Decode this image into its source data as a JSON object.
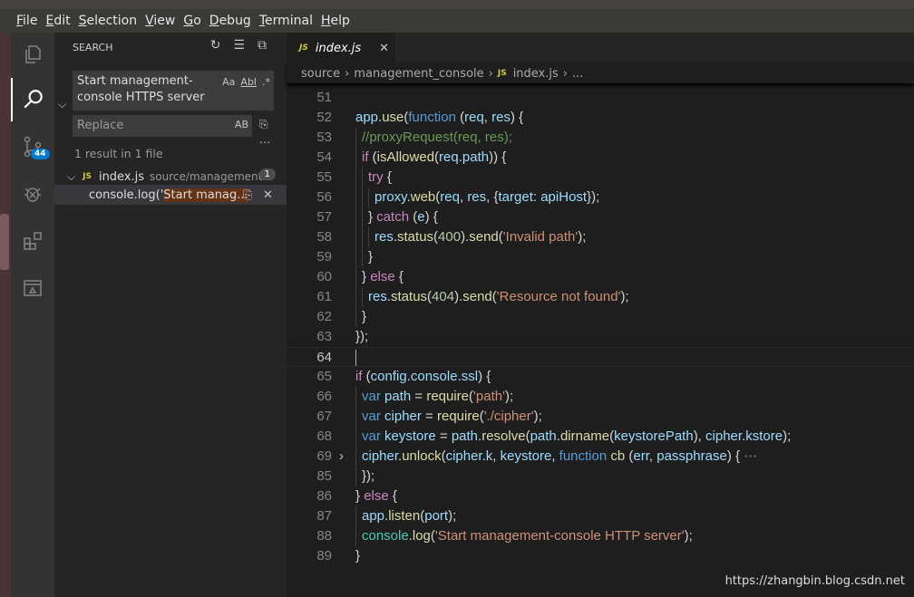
{
  "menu": [
    "File",
    "Edit",
    "Selection",
    "View",
    "Go",
    "Debug",
    "Terminal",
    "Help"
  ],
  "activity": {
    "scm_badge": "44"
  },
  "sidebar": {
    "title": "SEARCH",
    "search_value": "Start management-console HTTPS server",
    "opt_case": "Aa",
    "opt_word": "Abl",
    "opt_regex": ".*",
    "replace_placeholder": "Replace",
    "replace_ab": "AB",
    "summary": "1 result in 1 file",
    "file": {
      "name": "index.js",
      "path": "source/management...",
      "count": "1",
      "icon": "JS"
    },
    "match": {
      "prefix": "console.log('",
      "highlight": "Start manag..."
    }
  },
  "tab": {
    "icon": "JS",
    "label": "index.js"
  },
  "breadcrumb": [
    "source",
    "management_console",
    "index.js",
    "..."
  ],
  "code": [
    {
      "n": "51",
      "i": 0,
      "t": []
    },
    {
      "n": "52",
      "i": 0,
      "t": [
        [
          "app",
          "v"
        ],
        [
          ".",
          "p"
        ],
        [
          "use",
          "f"
        ],
        [
          "(",
          "p"
        ],
        [
          "function",
          "k"
        ],
        [
          " (",
          "p"
        ],
        [
          "req",
          "v"
        ],
        [
          ", ",
          "p"
        ],
        [
          "res",
          "v"
        ],
        [
          ") {",
          "p"
        ]
      ]
    },
    {
      "n": "53",
      "i": 1,
      "t": [
        [
          "//proxyRequest(req, res);",
          "m"
        ]
      ]
    },
    {
      "n": "54",
      "i": 1,
      "t": [
        [
          "if",
          "c"
        ],
        [
          " (",
          "p"
        ],
        [
          "isAllowed",
          "f"
        ],
        [
          "(",
          "p"
        ],
        [
          "req",
          "v"
        ],
        [
          ".",
          "p"
        ],
        [
          "path",
          "v"
        ],
        [
          ")) {",
          "p"
        ]
      ]
    },
    {
      "n": "55",
      "i": 2,
      "t": [
        [
          "try",
          "c"
        ],
        [
          " {",
          "p"
        ]
      ]
    },
    {
      "n": "56",
      "i": 3,
      "t": [
        [
          "proxy",
          "v"
        ],
        [
          ".",
          "p"
        ],
        [
          "web",
          "f"
        ],
        [
          "(",
          "p"
        ],
        [
          "req",
          "v"
        ],
        [
          ", ",
          "p"
        ],
        [
          "res",
          "v"
        ],
        [
          ", {",
          "p"
        ],
        [
          "target",
          "v"
        ],
        [
          ": ",
          "p"
        ],
        [
          "apiHost",
          "v"
        ],
        [
          "});",
          "p"
        ]
      ]
    },
    {
      "n": "57",
      "i": 2,
      "t": [
        [
          "} ",
          "p"
        ],
        [
          "catch",
          "c"
        ],
        [
          " (",
          "p"
        ],
        [
          "e",
          "v"
        ],
        [
          ") {",
          "p"
        ]
      ]
    },
    {
      "n": "58",
      "i": 3,
      "t": [
        [
          "res",
          "v"
        ],
        [
          ".",
          "p"
        ],
        [
          "status",
          "f"
        ],
        [
          "(",
          "p"
        ],
        [
          "400",
          "n"
        ],
        [
          ").",
          "p"
        ],
        [
          "send",
          "f"
        ],
        [
          "(",
          "p"
        ],
        [
          "'Invalid path'",
          "s"
        ],
        [
          ");",
          "p"
        ]
      ]
    },
    {
      "n": "59",
      "i": 2,
      "t": [
        [
          "}",
          "p"
        ]
      ]
    },
    {
      "n": "60",
      "i": 1,
      "t": [
        [
          "} ",
          "p"
        ],
        [
          "else",
          "c"
        ],
        [
          " {",
          "p"
        ]
      ]
    },
    {
      "n": "61",
      "i": 2,
      "t": [
        [
          "res",
          "v"
        ],
        [
          ".",
          "p"
        ],
        [
          "status",
          "f"
        ],
        [
          "(",
          "p"
        ],
        [
          "404",
          "n"
        ],
        [
          ").",
          "p"
        ],
        [
          "send",
          "f"
        ],
        [
          "(",
          "p"
        ],
        [
          "'Resource not found'",
          "s"
        ],
        [
          ");",
          "p"
        ]
      ]
    },
    {
      "n": "62",
      "i": 1,
      "t": [
        [
          "}",
          "p"
        ]
      ]
    },
    {
      "n": "63",
      "i": 0,
      "t": [
        [
          "});",
          "p"
        ]
      ]
    },
    {
      "n": "64",
      "i": 0,
      "t": [],
      "current": true
    },
    {
      "n": "65",
      "i": 0,
      "t": [
        [
          "if",
          "c"
        ],
        [
          " (",
          "p"
        ],
        [
          "config",
          "v"
        ],
        [
          ".",
          "p"
        ],
        [
          "console",
          "v"
        ],
        [
          ".",
          "p"
        ],
        [
          "ssl",
          "v"
        ],
        [
          ") {",
          "p"
        ]
      ]
    },
    {
      "n": "66",
      "i": 1,
      "t": [
        [
          "var",
          "k"
        ],
        [
          " ",
          "p"
        ],
        [
          "path",
          "v"
        ],
        [
          " = ",
          "p"
        ],
        [
          "require",
          "f"
        ],
        [
          "(",
          "p"
        ],
        [
          "'path'",
          "s"
        ],
        [
          ");",
          "p"
        ]
      ]
    },
    {
      "n": "67",
      "i": 1,
      "t": [
        [
          "var",
          "k"
        ],
        [
          " ",
          "p"
        ],
        [
          "cipher",
          "v"
        ],
        [
          " = ",
          "p"
        ],
        [
          "require",
          "f"
        ],
        [
          "(",
          "p"
        ],
        [
          "'./cipher'",
          "s"
        ],
        [
          ");",
          "p"
        ]
      ]
    },
    {
      "n": "68",
      "i": 1,
      "t": [
        [
          "var",
          "k"
        ],
        [
          " ",
          "p"
        ],
        [
          "keystore",
          "v"
        ],
        [
          " = ",
          "p"
        ],
        [
          "path",
          "v"
        ],
        [
          ".",
          "p"
        ],
        [
          "resolve",
          "f"
        ],
        [
          "(",
          "p"
        ],
        [
          "path",
          "v"
        ],
        [
          ".",
          "p"
        ],
        [
          "dirname",
          "f"
        ],
        [
          "(",
          "p"
        ],
        [
          "keystorePath",
          "v"
        ],
        [
          "), ",
          "p"
        ],
        [
          "cipher",
          "v"
        ],
        [
          ".",
          "p"
        ],
        [
          "kstore",
          "v"
        ],
        [
          ");",
          "p"
        ]
      ]
    },
    {
      "n": "69",
      "i": 1,
      "fold": true,
      "t": [
        [
          "cipher",
          "v"
        ],
        [
          ".",
          "p"
        ],
        [
          "unlock",
          "f"
        ],
        [
          "(",
          "p"
        ],
        [
          "cipher",
          "v"
        ],
        [
          ".",
          "p"
        ],
        [
          "k",
          "v"
        ],
        [
          ", ",
          "p"
        ],
        [
          "keystore",
          "v"
        ],
        [
          ", ",
          "p"
        ],
        [
          "function",
          "k"
        ],
        [
          " ",
          "p"
        ],
        [
          "cb",
          "f"
        ],
        [
          " (",
          "p"
        ],
        [
          "err",
          "v"
        ],
        [
          ", ",
          "p"
        ],
        [
          "passphrase",
          "v"
        ],
        [
          ") { ",
          "p"
        ],
        [
          "⋯",
          "e"
        ]
      ]
    },
    {
      "n": "85",
      "i": 1,
      "t": [
        [
          "});",
          "p"
        ]
      ]
    },
    {
      "n": "86",
      "i": 0,
      "t": [
        [
          "} ",
          "p"
        ],
        [
          "else",
          "c"
        ],
        [
          " {",
          "p"
        ]
      ]
    },
    {
      "n": "87",
      "i": 1,
      "t": [
        [
          "app",
          "v"
        ],
        [
          ".",
          "p"
        ],
        [
          "listen",
          "f"
        ],
        [
          "(",
          "p"
        ],
        [
          "port",
          "v"
        ],
        [
          ");",
          "p"
        ]
      ]
    },
    {
      "n": "88",
      "i": 1,
      "t": [
        [
          "console",
          "t"
        ],
        [
          ".",
          "p"
        ],
        [
          "log",
          "f"
        ],
        [
          "(",
          "p"
        ],
        [
          "'Start management-console HTTP server'",
          "s"
        ],
        [
          ");",
          "p"
        ]
      ]
    },
    {
      "n": "89",
      "i": 0,
      "t": [
        [
          "}",
          "p"
        ]
      ]
    }
  ],
  "watermark": "https://zhangbin.blog.csdn.net"
}
